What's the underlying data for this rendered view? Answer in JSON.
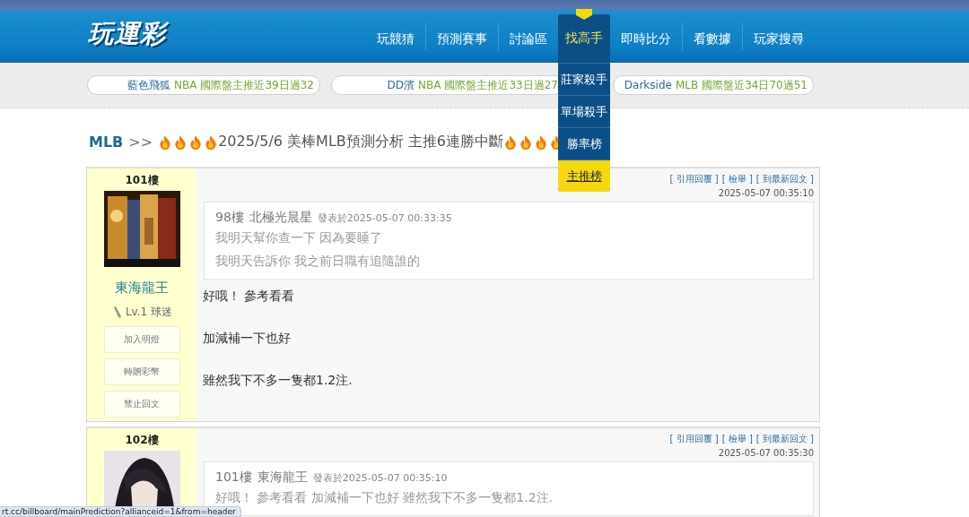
{
  "logo": "玩運彩",
  "nav": [
    {
      "label": "玩競猜",
      "selected": false
    },
    {
      "label": "預測賽事",
      "selected": false
    },
    {
      "label": "討論區",
      "selected": false
    },
    {
      "label": "找高手",
      "selected": true,
      "menu": [
        {
          "label": "莊家殺手",
          "selected": false
        },
        {
          "label": "單場殺手",
          "selected": false
        },
        {
          "label": "勝率榜",
          "selected": false
        },
        {
          "label": "主推榜",
          "selected": true
        }
      ]
    },
    {
      "label": "即時比分",
      "selected": false
    },
    {
      "label": "看數據",
      "selected": false
    },
    {
      "label": "玩家搜尋",
      "selected": false
    }
  ],
  "ticker": [
    {
      "name": "藍色飛狐",
      "league": "NBA",
      "record": "國際盤主推近39日過32"
    },
    {
      "name": "DD濱",
      "league": "NBA",
      "record": "國際盤主推近33日過27"
    },
    {
      "name": "Darkside",
      "league": "MLB",
      "record": "國際盤近34日70過51"
    }
  ],
  "breadcrumb": {
    "section": "MLB",
    "separator": ">>",
    "title": "2025/5/6 美棒MLB預測分析 主推6連勝中斷"
  },
  "posts": [
    {
      "floor": "101樓",
      "avatar": {
        "kind": "picture"
      },
      "author": "東海龍王",
      "level": "Lv.1 球迷",
      "buttons": [
        "加入明燈",
        "轉贈彩幣",
        "禁止回文"
      ],
      "actions": [
        "[ 引用回覆 ]",
        "[ 檢舉 ]",
        "[ 到最新回文 ]"
      ],
      "time": "2025-05-07 00:35:10",
      "quote": {
        "floor": "98樓",
        "author": "北極光晨星",
        "posted": "發表於2025-05-07 00:33:35",
        "lines": [
          "我明天幫你查一下 因為要睡了",
          "我明天告訴你 我之前日職有追隨誰的"
        ]
      },
      "body": [
        "好哦！ 參考看看",
        "加減補一下也好",
        "雖然我下不多一隻都1.2注."
      ]
    },
    {
      "floor": "102樓",
      "avatar": {
        "kind": "picture"
      },
      "actions": [
        "[ 引用回覆 ]",
        "[ 檢舉 ]",
        "[ 到最新回文 ]"
      ],
      "time": "2025-05-07 00:35:30",
      "quote": {
        "floor": "101樓",
        "author": "東海龍王",
        "posted": "發表於2025-05-07 00:35:10",
        "lines": [
          "好哦！ 參考看看 加減補一下也好 雖然我下不多一隻都1.2注."
        ]
      }
    }
  ],
  "status_url": "rt.cc/billboard/mainPrediction?allianceid=1&from=header"
}
